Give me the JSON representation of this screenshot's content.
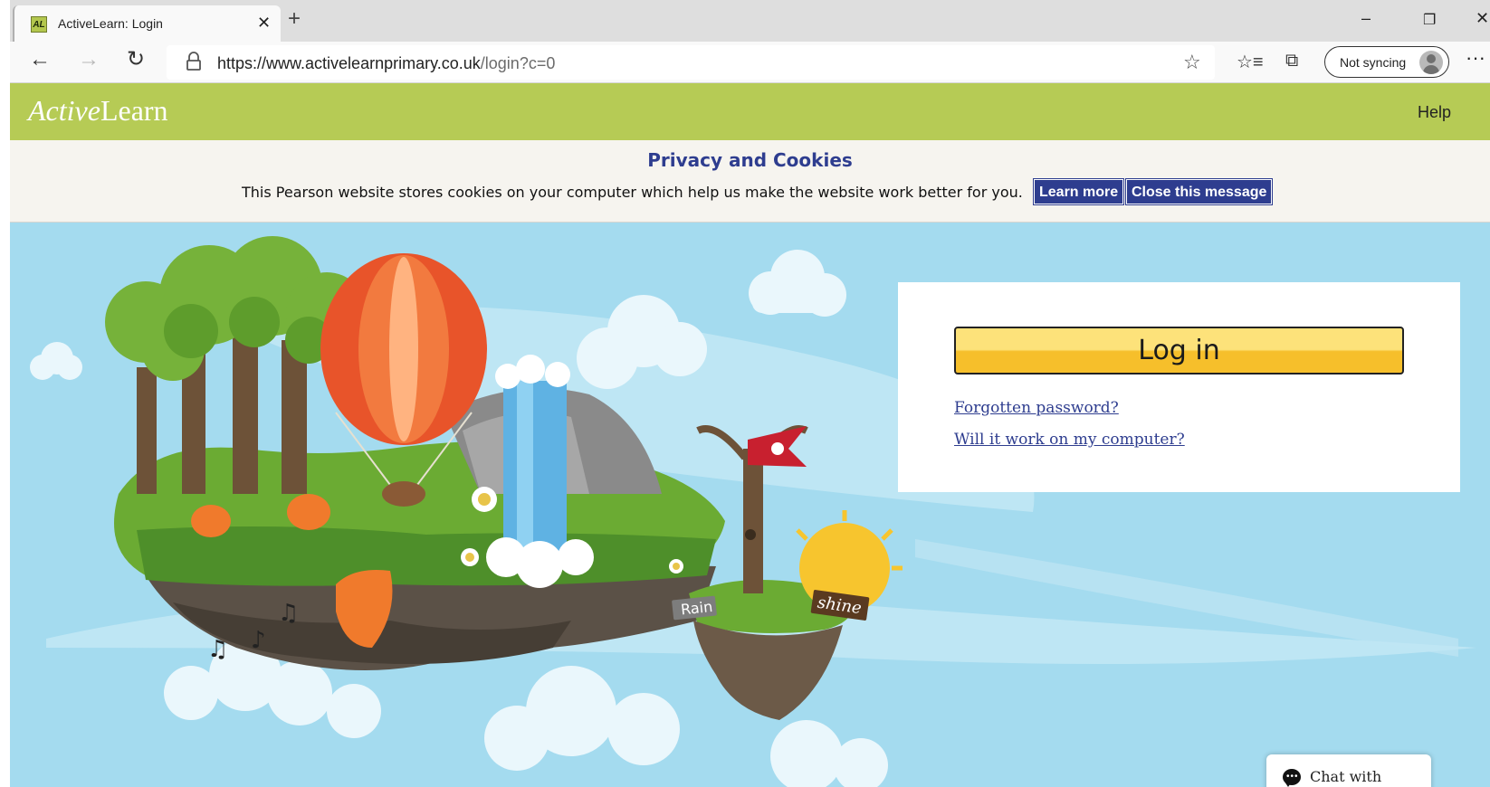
{
  "browser": {
    "tab": {
      "favicon_text": "AL",
      "title": "ActiveLearn: Login",
      "close_glyph": "✕"
    },
    "new_tab_glyph": "+",
    "window_controls": {
      "minimize": "–",
      "restore": "❐",
      "close": "✕"
    },
    "nav": {
      "back": "←",
      "forward": "→",
      "reload": "↻"
    },
    "address": {
      "host": "https://www.activelearnprimary.co.uk",
      "path": "/login?c=0"
    },
    "icons": [
      "lock-icon",
      "favorite-star-icon",
      "favorites-list-icon",
      "collections-icon",
      "profile-avatar-icon",
      "more-menu-icon"
    ],
    "sync_label": "Not syncing",
    "more_glyph": "···"
  },
  "site": {
    "logo": {
      "part1": "Active",
      "part2": "Learn"
    },
    "help_label": "Help",
    "brand_color": "#b6cb55"
  },
  "cookie_banner": {
    "title": "Privacy and Cookies",
    "message": "This Pearson website stores cookies on your computer which help us make the website work better for you.",
    "learn_more": "Learn more",
    "close": "Close this message",
    "button_color": "#2e3d8f"
  },
  "login": {
    "button_label": "Log in",
    "forgotten_password": "Forgotten password?",
    "compatibility": "Will it work on my computer?"
  },
  "hero": {
    "signs": {
      "rain": "Rain",
      "shine": "shine"
    },
    "sky_color": "#a4dbef"
  },
  "chat": {
    "label": "Chat with support"
  }
}
